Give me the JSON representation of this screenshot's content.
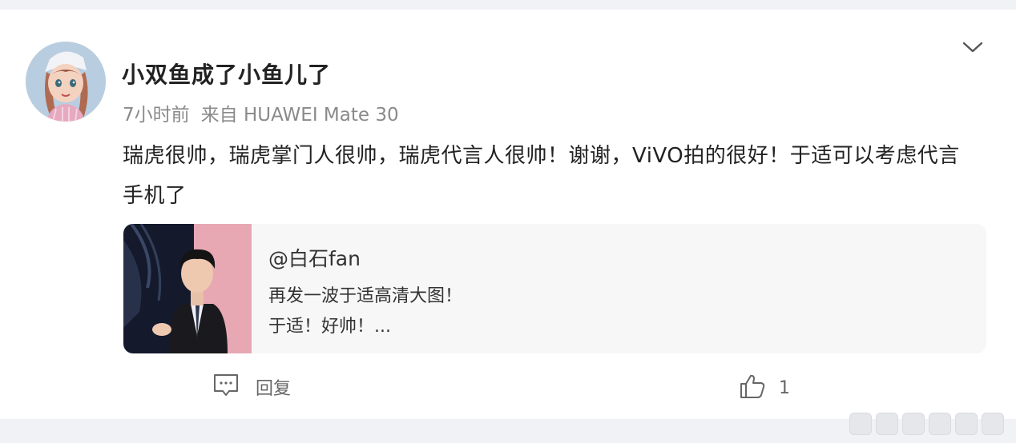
{
  "post": {
    "username": "小双鱼成了小鱼儿了",
    "time": "7小时前",
    "source": "来自 HUAWEI Mate 30",
    "content": "瑞虎很帅，瑞虎掌门人很帅，瑞虎代言人很帅！谢谢，ViVO拍的很好！于适可以考虑代言手机了"
  },
  "repost": {
    "author": "@白石fan",
    "line1": "再发一波于适高清大图！",
    "line2": "于适！好帅！..."
  },
  "actions": {
    "reply_label": "回复",
    "like_count": "1"
  },
  "icons": {
    "menu": "chevron-down-icon",
    "reply": "comment-icon",
    "like": "thumbs-up-icon"
  },
  "colors": {
    "background": "#f1f2f5",
    "card": "#ffffff",
    "repost_background": "#f7f7f8",
    "meta_text": "#8a8a8a"
  }
}
